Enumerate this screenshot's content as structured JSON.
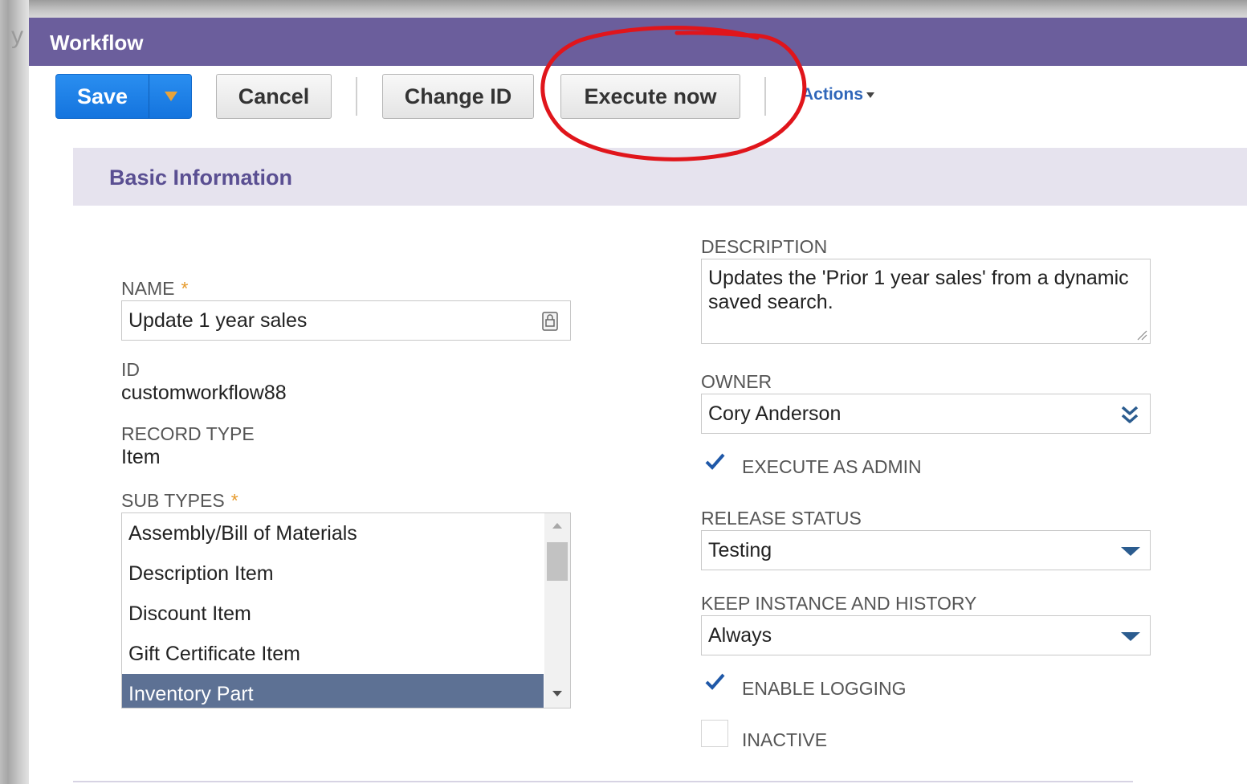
{
  "background": {
    "letter": "y"
  },
  "dialog": {
    "title": "Workflow",
    "accent": "#6b5e9c"
  },
  "toolbar": {
    "save_label": "Save",
    "cancel_label": "Cancel",
    "change_id_label": "Change ID",
    "execute_now_label": "Execute now",
    "actions_label": "Actions"
  },
  "annotation": {
    "color": "#e0151b",
    "description": "red circle around Execute now"
  },
  "section": {
    "title": "Basic Information"
  },
  "fields": {
    "name": {
      "label": "NAME",
      "required_mark": "*",
      "value": "Update 1 year sales"
    },
    "id": {
      "label": "ID",
      "value": "customworkflow88"
    },
    "record_type": {
      "label": "RECORD TYPE",
      "value": "Item"
    },
    "sub_types": {
      "label": "SUB TYPES",
      "required_mark": "*",
      "options": [
        "Assembly/Bill of Materials",
        "Description Item",
        "Discount Item",
        "Gift Certificate Item",
        "Inventory Part"
      ],
      "selected": "Inventory Part"
    },
    "description": {
      "label": "DESCRIPTION",
      "value": "Updates the 'Prior 1 year sales' from a dynamic saved search."
    },
    "owner": {
      "label": "OWNER",
      "value": "Cory Anderson"
    },
    "execute_as_admin": {
      "label": "EXECUTE AS ADMIN",
      "checked": true
    },
    "release_status": {
      "label": "RELEASE STATUS",
      "value": "Testing"
    },
    "keep_instance": {
      "label": "KEEP INSTANCE AND HISTORY",
      "value": "Always"
    },
    "enable_logging": {
      "label": "ENABLE LOGGING",
      "checked": true
    },
    "inactive": {
      "label": "INACTIVE",
      "checked": false
    }
  },
  "icons": {
    "lock": "lock-icon",
    "double_chevron": "double-chevron-down-icon",
    "dropdown": "chevron-down-icon",
    "check": "checkmark-icon"
  }
}
